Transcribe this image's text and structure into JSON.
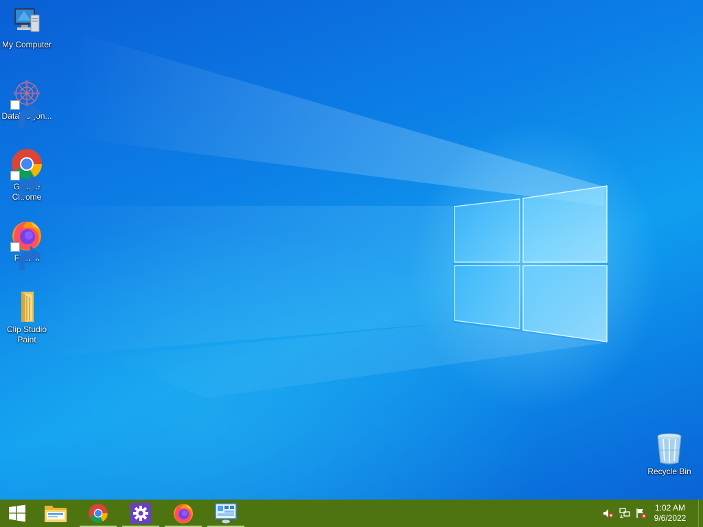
{
  "desktop": {
    "icons": [
      {
        "label": "My Computer",
        "icon": "computer-icon",
        "shortcut": false
      },
      {
        "label": "DataWagon...",
        "icon": "datawagon-icon",
        "shortcut": true
      },
      {
        "label": "Google Chrome",
        "icon": "chrome-icon",
        "shortcut": true
      },
      {
        "label": "Firefox",
        "icon": "firefox-icon",
        "shortcut": true
      },
      {
        "label": "Clip Studio Paint",
        "icon": "folder-icon",
        "shortcut": false
      }
    ],
    "recycle_bin": {
      "label": "Recycle Bin",
      "icon": "recycle-bin-icon"
    }
  },
  "taskbar": {
    "color": "#4e7411",
    "start_icon": "windows-logo-icon",
    "pinned": [
      {
        "icon": "file-explorer-icon",
        "running": false
      },
      {
        "icon": "chrome-icon",
        "running": true
      },
      {
        "icon": "settings-gear-icon",
        "running": true
      },
      {
        "icon": "firefox-icon",
        "running": true
      },
      {
        "icon": "control-panel-icon",
        "running": true
      }
    ],
    "tray": {
      "icons": [
        "volume-muted-icon",
        "network-disconnected-icon",
        "action-center-flag-icon"
      ],
      "time": "1:02 AM",
      "date": "9/6/2022"
    }
  }
}
